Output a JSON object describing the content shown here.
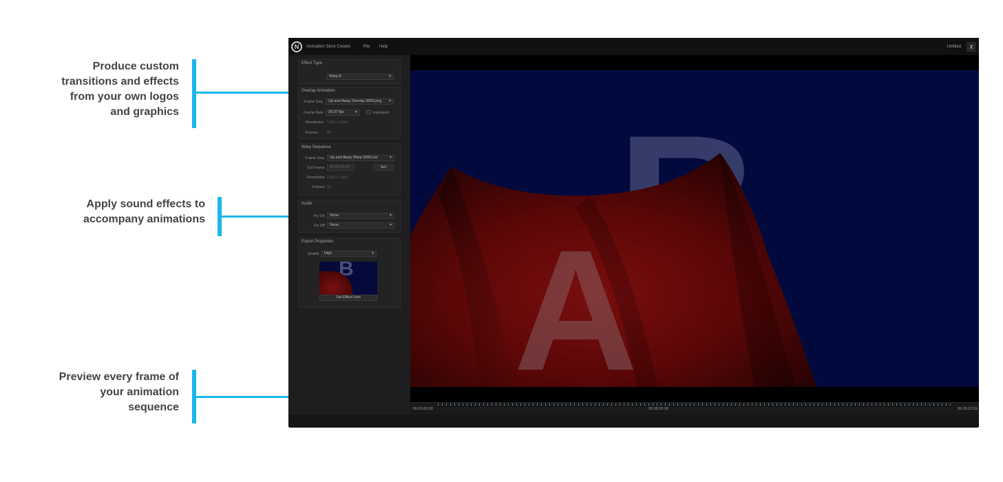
{
  "callouts": [
    {
      "lines": [
        "Produce custom",
        "transitions and effects",
        "from your own logos",
        "and graphics"
      ]
    },
    {
      "lines": [
        "Apply sound effects to",
        "accompany animations"
      ]
    },
    {
      "lines": [
        "Preview every frame of",
        "your animation",
        "sequence"
      ]
    }
  ],
  "colors": {
    "accent": "#1ab7ea",
    "text": "#444444",
    "app_bg": "#1c1c1c",
    "viewport_bg": "#020a3d",
    "cloth": "#6a0a0a"
  },
  "app": {
    "title": "Animation Store Creator",
    "menu": [
      "File",
      "Help"
    ],
    "document_title": "Untitled",
    "close_label": "X",
    "logo_icon": "app-logo-icon"
  },
  "sidebar": {
    "effect_type": {
      "title": "Effect Type",
      "value": "Warp A"
    },
    "overlay_animation": {
      "title": "Overlay Animation",
      "frame_seq_label": "Frame Seq.",
      "frame_seq_value": "Up and Away Overlay 0000.png",
      "frame_rate_label": "Frame Rate",
      "frame_rate_value": "29.97 fps",
      "interlaced_label": "Interlaced",
      "resolution_label": "Resolution",
      "resolution_value": "1920 x 1080",
      "frames_label": "Frames",
      "frames_value": "60"
    },
    "warp_sequence": {
      "title": "Warp Sequence",
      "frame_seq_label": "Frame Seq.",
      "frame_seq_value": "Up and Away Warp 0000.exr",
      "cut_frame_label": "Cut Frame",
      "cut_frame_value": "00.00.00.01",
      "set_label": "Set",
      "resolution_label": "Resolution",
      "resolution_value": "1920 x 1080",
      "frames_label": "Frames",
      "frames_value": "60"
    },
    "audio": {
      "title": "Audio",
      "fly_on_label": "Fly On",
      "fly_on_value": "None",
      "fly_off_label": "Fly Off",
      "fly_off_value": "None"
    },
    "export": {
      "title": "Export Properties",
      "quality_label": "Quality",
      "quality_value": "High",
      "set_icon_label": "Set Effect Icon"
    }
  },
  "preview": {
    "letter_back": "B",
    "letter_front": "A",
    "thumb_letter": "B"
  },
  "timeline": {
    "start": "00.00.00.00",
    "current": "00.00.00.26",
    "end": "00.00.02.01"
  }
}
